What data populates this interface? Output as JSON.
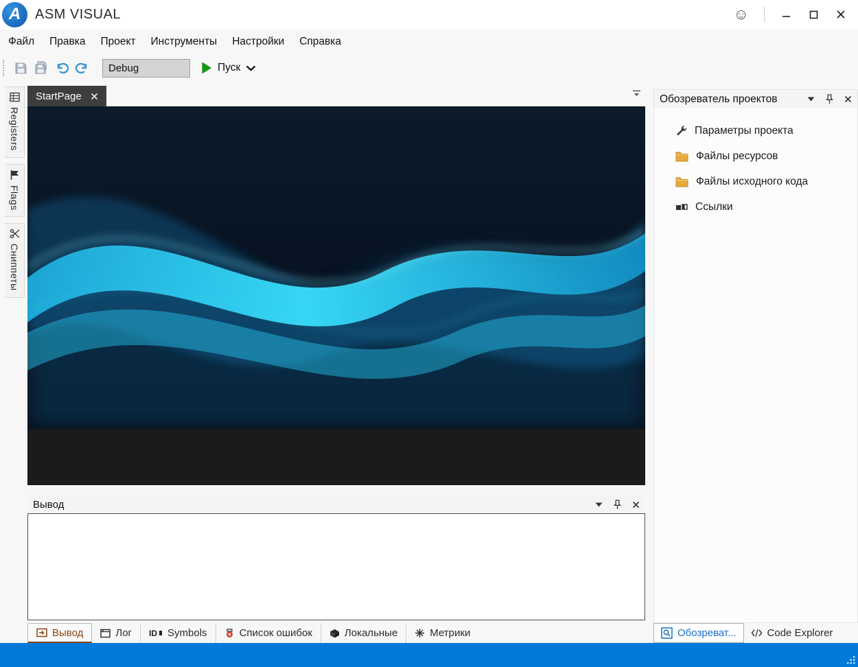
{
  "window": {
    "title": "ASM VISUAL",
    "logo_letter": "A",
    "icons": [
      "smiley-icon",
      "minimize-icon",
      "maximize-icon",
      "close-icon"
    ]
  },
  "menu": {
    "items": [
      "Файл",
      "Правка",
      "Проект",
      "Инструменты",
      "Настройки",
      "Справка"
    ]
  },
  "toolbar": {
    "configuration": "Debug",
    "run_label": "Пуск",
    "icons": [
      "save-icon",
      "save-all-icon",
      "undo-icon",
      "redo-icon",
      "play-icon",
      "chevron-down-icon"
    ]
  },
  "left_rail": {
    "tabs": [
      {
        "label": "Registers",
        "icon": "registers-icon"
      },
      {
        "label": "Flags",
        "icon": "flag-icon"
      },
      {
        "label": "Сниппеты",
        "icon": "snippets-icon"
      }
    ]
  },
  "editor": {
    "active_tab": "StartPage"
  },
  "project_explorer": {
    "title": "Обозреватель проектов",
    "items": [
      {
        "label": "Параметры проекта",
        "icon": "wrench-icon"
      },
      {
        "label": "Файлы ресурсов",
        "icon": "folder-icon"
      },
      {
        "label": "Файлы исходного кода",
        "icon": "folder-icon"
      },
      {
        "label": "Ссылки",
        "icon": "references-icon"
      }
    ]
  },
  "output_panel": {
    "title": "Вывод",
    "content": ""
  },
  "bottom_tabs": [
    {
      "label": "Вывод",
      "icon": "output-icon",
      "active": true
    },
    {
      "label": "Лог",
      "icon": "log-icon",
      "active": false
    },
    {
      "label": "Symbols",
      "icon": "symbols-icon",
      "active": false
    },
    {
      "label": "Список ошибок",
      "icon": "error-list-icon",
      "active": false
    },
    {
      "label": "Локальные",
      "icon": "locals-icon",
      "active": false
    },
    {
      "label": "Метрики",
      "icon": "metrics-icon",
      "active": false
    }
  ],
  "right_tabs": [
    {
      "label": "Обозреват...",
      "icon": "search-explorer-icon",
      "active": true
    },
    {
      "label": "Code Explorer",
      "icon": "code-explorer-icon",
      "active": false
    }
  ],
  "colors": {
    "statusbar": "#0079d8",
    "accent_blue": "#1a6fc4",
    "folder": "#e8a93d",
    "editor_tab_dark": "#3d3d3d",
    "selected_bottom_tab": "#8b4513"
  }
}
